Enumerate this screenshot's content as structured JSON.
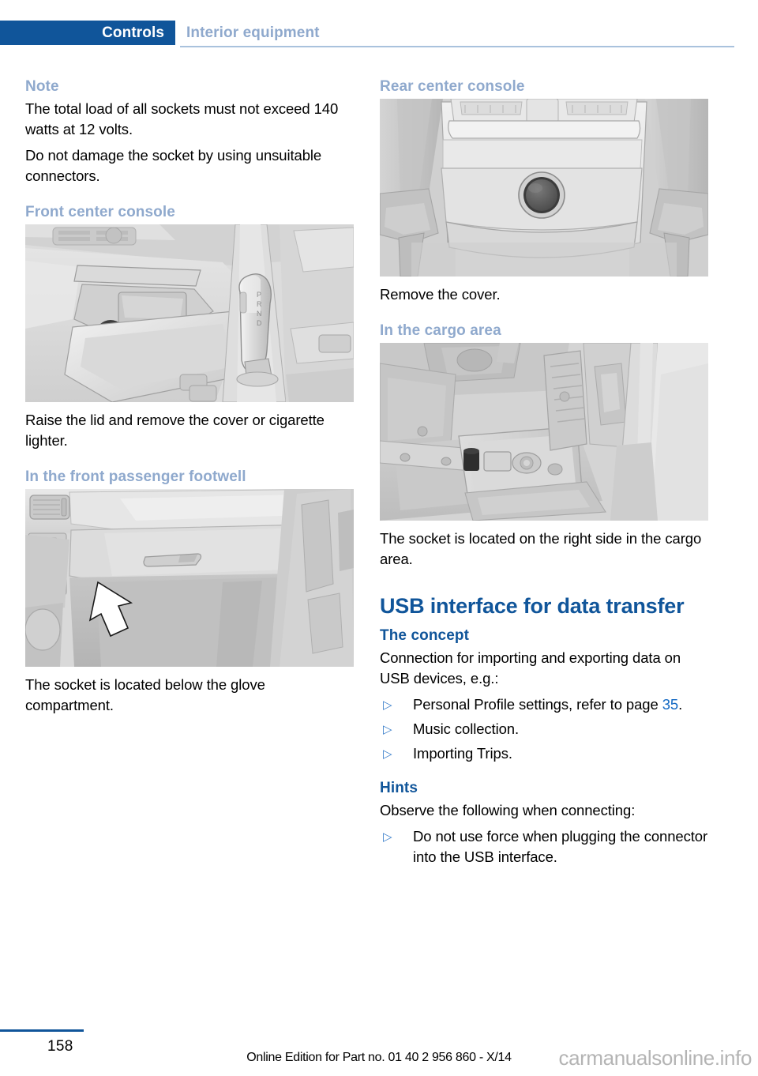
{
  "header": {
    "chapter_label": "Controls",
    "subject_label": "Interior equipment"
  },
  "left_column": {
    "note_heading": "Note",
    "note_paragraph_1": "The total load of all sockets must not exceed 140 watts at 12 volts.",
    "note_paragraph_2": "Do not damage the socket by using unsuitable connectors.",
    "front_console_heading": "Front center console",
    "front_console_caption": "Raise the lid and remove the cover or cigarette lighter.",
    "footwell_heading": "In the front passenger footwell",
    "footwell_caption": "The socket is located below the glove compartment.",
    "figure_front_console_alt": "front-center-console-illustration",
    "figure_footwell_alt": "front-passenger-footwell-illustration"
  },
  "right_column": {
    "rear_console_heading": "Rear center console",
    "rear_console_caption": "Remove the cover.",
    "cargo_heading": "In the cargo area",
    "cargo_caption": "The socket is located on the right side in the cargo area.",
    "usb_heading": "USB interface for data transfer",
    "concept_heading": "The concept",
    "concept_intro": "Connection for importing and exporting data on USB devices, e.g.:",
    "concept_items": [
      {
        "text_before": "Personal Profile settings, refer to page ",
        "page_ref": "35",
        "text_after": "."
      },
      {
        "text_before": "Music collection.",
        "page_ref": "",
        "text_after": ""
      },
      {
        "text_before": "Importing Trips.",
        "page_ref": "",
        "text_after": ""
      }
    ],
    "hints_heading": "Hints",
    "hints_intro": "Observe the following when connecting:",
    "hints_items": [
      {
        "text_before": "Do not use force when plugging the connector into the USB interface.",
        "page_ref": "",
        "text_after": ""
      }
    ],
    "figure_rear_console_alt": "rear-center-console-illustration",
    "figure_cargo_alt": "cargo-area-socket-illustration"
  },
  "bullet_glyph": "▷",
  "footer": {
    "page_number": "158",
    "edition_text": "Online Edition for Part no. 01 40 2 956 860 - X/14",
    "watermark": "carmanualsonline.info"
  },
  "colors": {
    "chapter_tab_bg": "#10559a",
    "heading_blue": "#10559a",
    "subheading_light_blue": "#8fa9cd",
    "link_blue": "#1268c3",
    "rule_blue": "#a9c2dd",
    "watermark_gray": "#b4b4b4"
  }
}
